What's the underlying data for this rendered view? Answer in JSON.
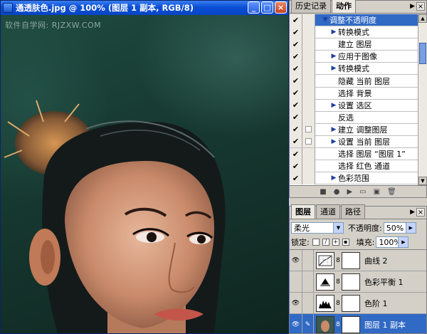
{
  "document": {
    "title": "通透肤色.jpg @ 100% (图层 1 副本, RGB/8)",
    "watermark": "软件自学网: RJZXW.COM",
    "buttons": {
      "minimize": "_",
      "maximize": "□",
      "close": "×"
    }
  },
  "actions_panel": {
    "tabs": [
      "历史记录",
      "动作"
    ],
    "active_tab": 1,
    "items": [
      {
        "label": "调整不透明度",
        "indent": 0,
        "triangle": "open",
        "selected": true,
        "dialog": false
      },
      {
        "label": "转换模式",
        "indent": 1,
        "triangle": "closed",
        "selected": false,
        "dialog": false
      },
      {
        "label": "建立 图层",
        "indent": 1,
        "triangle": "none",
        "selected": false,
        "dialog": false
      },
      {
        "label": "应用于图像",
        "indent": 1,
        "triangle": "closed",
        "selected": false,
        "dialog": false
      },
      {
        "label": "转换模式",
        "indent": 1,
        "triangle": "closed",
        "selected": false,
        "dialog": false
      },
      {
        "label": "隐藏 当前 图层",
        "indent": 1,
        "triangle": "none",
        "selected": false,
        "dialog": false
      },
      {
        "label": "选择 背景",
        "indent": 1,
        "triangle": "none",
        "selected": false,
        "dialog": false
      },
      {
        "label": "设置 选区",
        "indent": 1,
        "triangle": "closed",
        "selected": false,
        "dialog": false
      },
      {
        "label": "反选",
        "indent": 1,
        "triangle": "none",
        "selected": false,
        "dialog": false
      },
      {
        "label": "建立 调整图层",
        "indent": 1,
        "triangle": "closed",
        "selected": false,
        "dialog": true
      },
      {
        "label": "设置 当前 图层",
        "indent": 1,
        "triangle": "closed",
        "selected": false,
        "dialog": true
      },
      {
        "label": "选择 图层 “图层 1”",
        "indent": 1,
        "triangle": "none",
        "selected": false,
        "dialog": false
      },
      {
        "label": "选择 红色 通道",
        "indent": 1,
        "triangle": "none",
        "selected": false,
        "dialog": false
      },
      {
        "label": "色彩范围",
        "indent": 1,
        "triangle": "closed",
        "selected": false,
        "dialog": false
      }
    ],
    "toolbar_icons": [
      "stop-icon",
      "record-icon",
      "play-icon",
      "new-set-icon",
      "new-action-icon",
      "delete-icon"
    ]
  },
  "layers_panel": {
    "tabs": [
      "图层",
      "通道",
      "路径"
    ],
    "active_tab": 0,
    "blend_mode": "柔光",
    "opacity_label": "不透明度:",
    "opacity_value": "50%",
    "lock_label": "锁定:",
    "fill_label": "填充:",
    "fill_value": "100%",
    "layers": [
      {
        "name": "曲线 2",
        "type": "curves",
        "visible": true,
        "selected": false
      },
      {
        "name": "色彩平衡 1",
        "type": "color-balance",
        "visible": false,
        "selected": false
      },
      {
        "name": "色阶 1",
        "type": "levels",
        "visible": true,
        "selected": false
      },
      {
        "name": "图层 1 副本",
        "type": "pixel",
        "visible": true,
        "selected": true
      }
    ]
  },
  "colors": {
    "titlebar": "#0a4fd6",
    "selection": "#316ac5",
    "panel_bg": "#d4d0c8"
  }
}
